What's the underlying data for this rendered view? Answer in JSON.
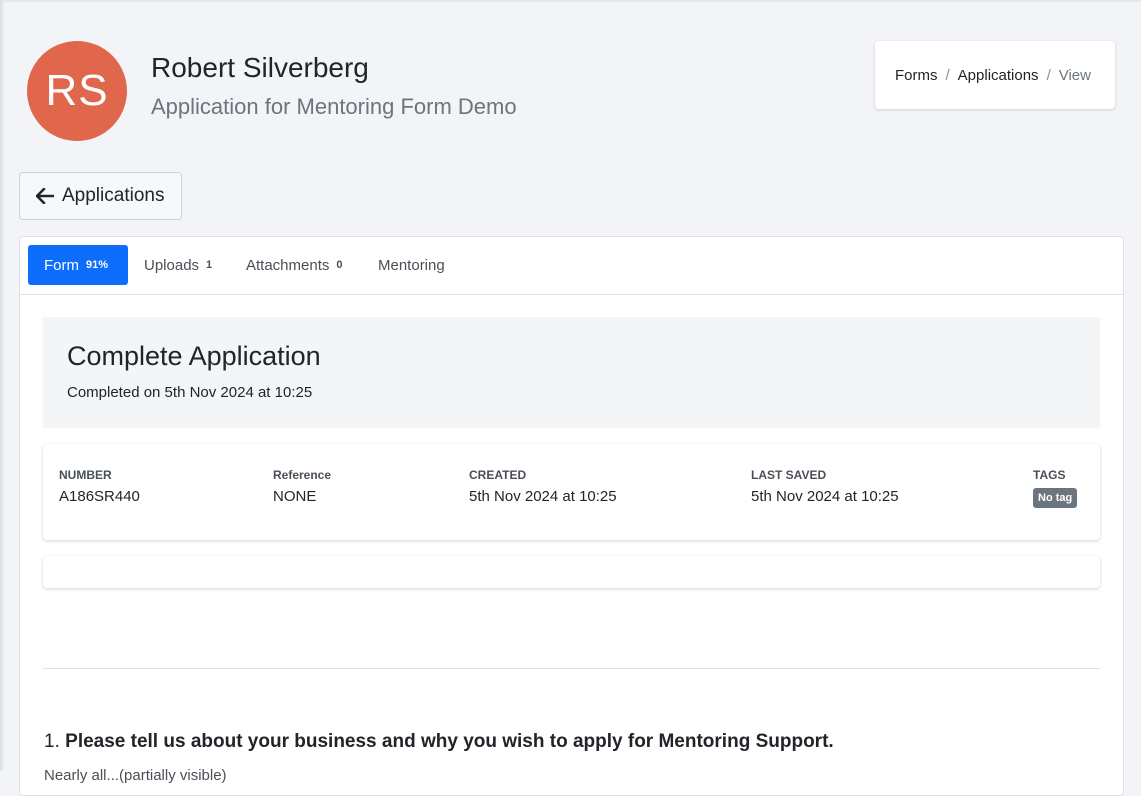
{
  "header": {
    "avatar_initials": "RS",
    "avatar_color": "#e0674b",
    "user_name": "Robert Silverberg",
    "form_name": "Application for Mentoring Form Demo"
  },
  "breadcrumb": {
    "items": [
      "Forms",
      "Applications",
      "View"
    ],
    "separator": "/"
  },
  "back_button": {
    "label": "Applications",
    "icon": "arrow-left-icon"
  },
  "tabs": [
    {
      "label": "Form",
      "count": "91%",
      "active": true
    },
    {
      "label": "Uploads",
      "count": "1",
      "active": false
    },
    {
      "label": "Attachments",
      "count": "0",
      "active": false
    },
    {
      "label": "Mentoring",
      "count": "",
      "active": false
    }
  ],
  "status": {
    "title": "Complete Application",
    "completed_text": "Completed on 5th Nov 2024 at 10:25"
  },
  "meta": {
    "number": {
      "label": "NUMBER",
      "value": "A186SR440"
    },
    "reference": {
      "label": "Reference",
      "value": "NONE"
    },
    "created": {
      "label": "CREATED",
      "value": "5th Nov 2024 at 10:25"
    },
    "last_saved": {
      "label": "LAST SAVED",
      "value": "5th Nov 2024 at 10:25"
    },
    "tags": {
      "label": "TAGS",
      "badge": "No tag"
    }
  },
  "question": {
    "number": "1.",
    "text": "Please tell us about your business and why you wish to apply for Mentoring Support.",
    "help": "Nearly all...(partially visible)"
  },
  "colors": {
    "accent": "#0d6efd",
    "badge": "#6c757d",
    "background": "#f2f4f7"
  }
}
